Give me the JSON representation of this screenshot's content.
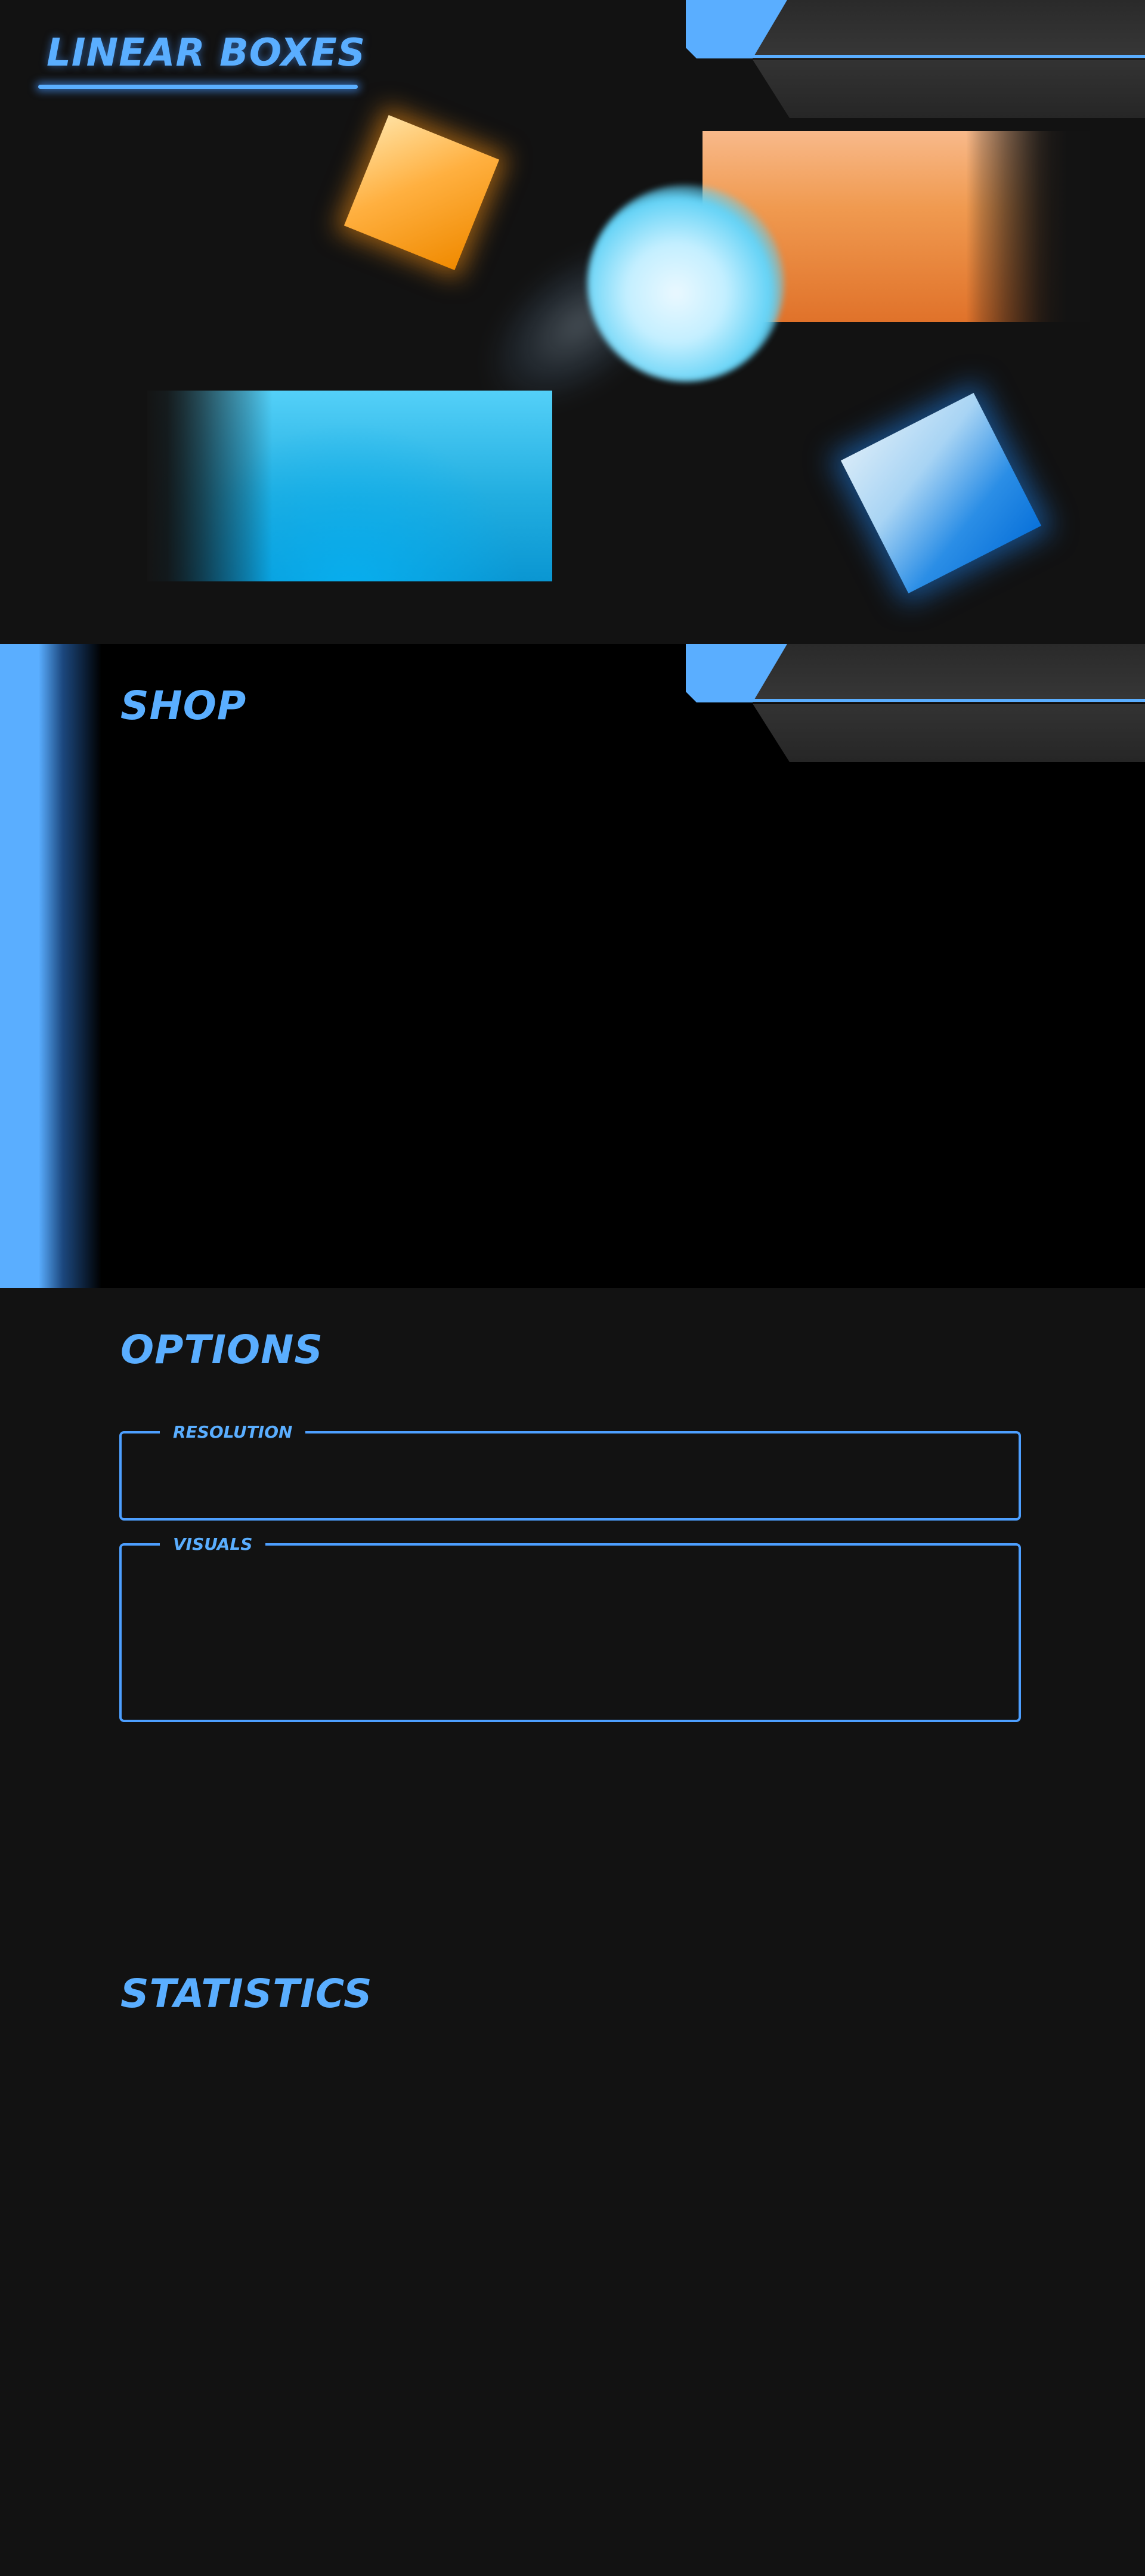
{
  "menu": {
    "game_title": "LINEAR BOXES"
  },
  "shop": {
    "title": "SHOP"
  },
  "options": {
    "title": "OPTIONS",
    "groups": [
      {
        "label": "RESOLUTION"
      },
      {
        "label": "VISUALS"
      }
    ]
  },
  "statistics": {
    "title": "STATISTICS"
  },
  "colors": {
    "accent": "#5aaeff",
    "background": "#121212",
    "shop_background": "#000000",
    "orange": "#f0962e",
    "cyan": "#22b4e8"
  }
}
